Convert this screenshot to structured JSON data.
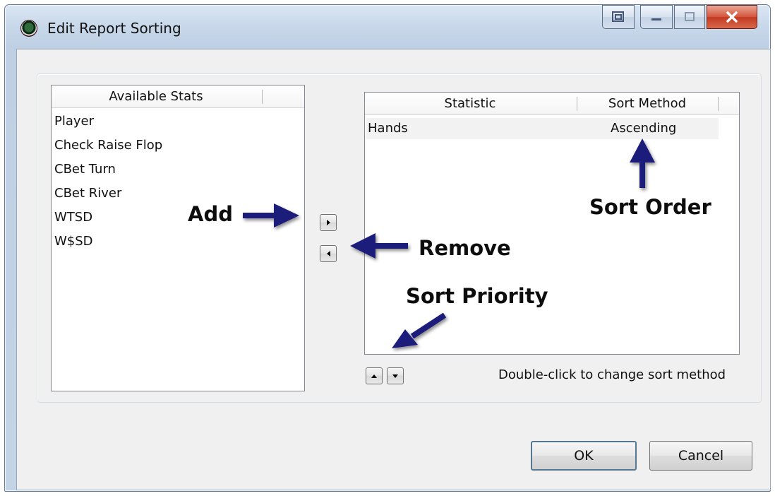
{
  "window": {
    "title": "Edit Report Sorting",
    "caption_buttons": {
      "help": "⧉",
      "minimize": "–",
      "maximize": "▫",
      "close": "X"
    }
  },
  "available_stats": {
    "header": "Available Stats",
    "items": [
      "Player",
      "Check Raise Flop",
      "CBet Turn",
      "CBet River",
      "WTSD",
      "W$SD"
    ]
  },
  "sort_table": {
    "columns": [
      "Statistic",
      "Sort Method"
    ],
    "rows": [
      {
        "statistic": "Hands",
        "sort_method": "Ascending"
      }
    ]
  },
  "hint": "Double-click to change sort method",
  "buttons": {
    "ok": "OK",
    "cancel": "Cancel"
  },
  "annotations": {
    "add": "Add",
    "remove": "Remove",
    "sort_order": "Sort Order",
    "sort_priority": "Sort Priority"
  },
  "colors": {
    "annotation_arrow": "#1a1a7a"
  }
}
